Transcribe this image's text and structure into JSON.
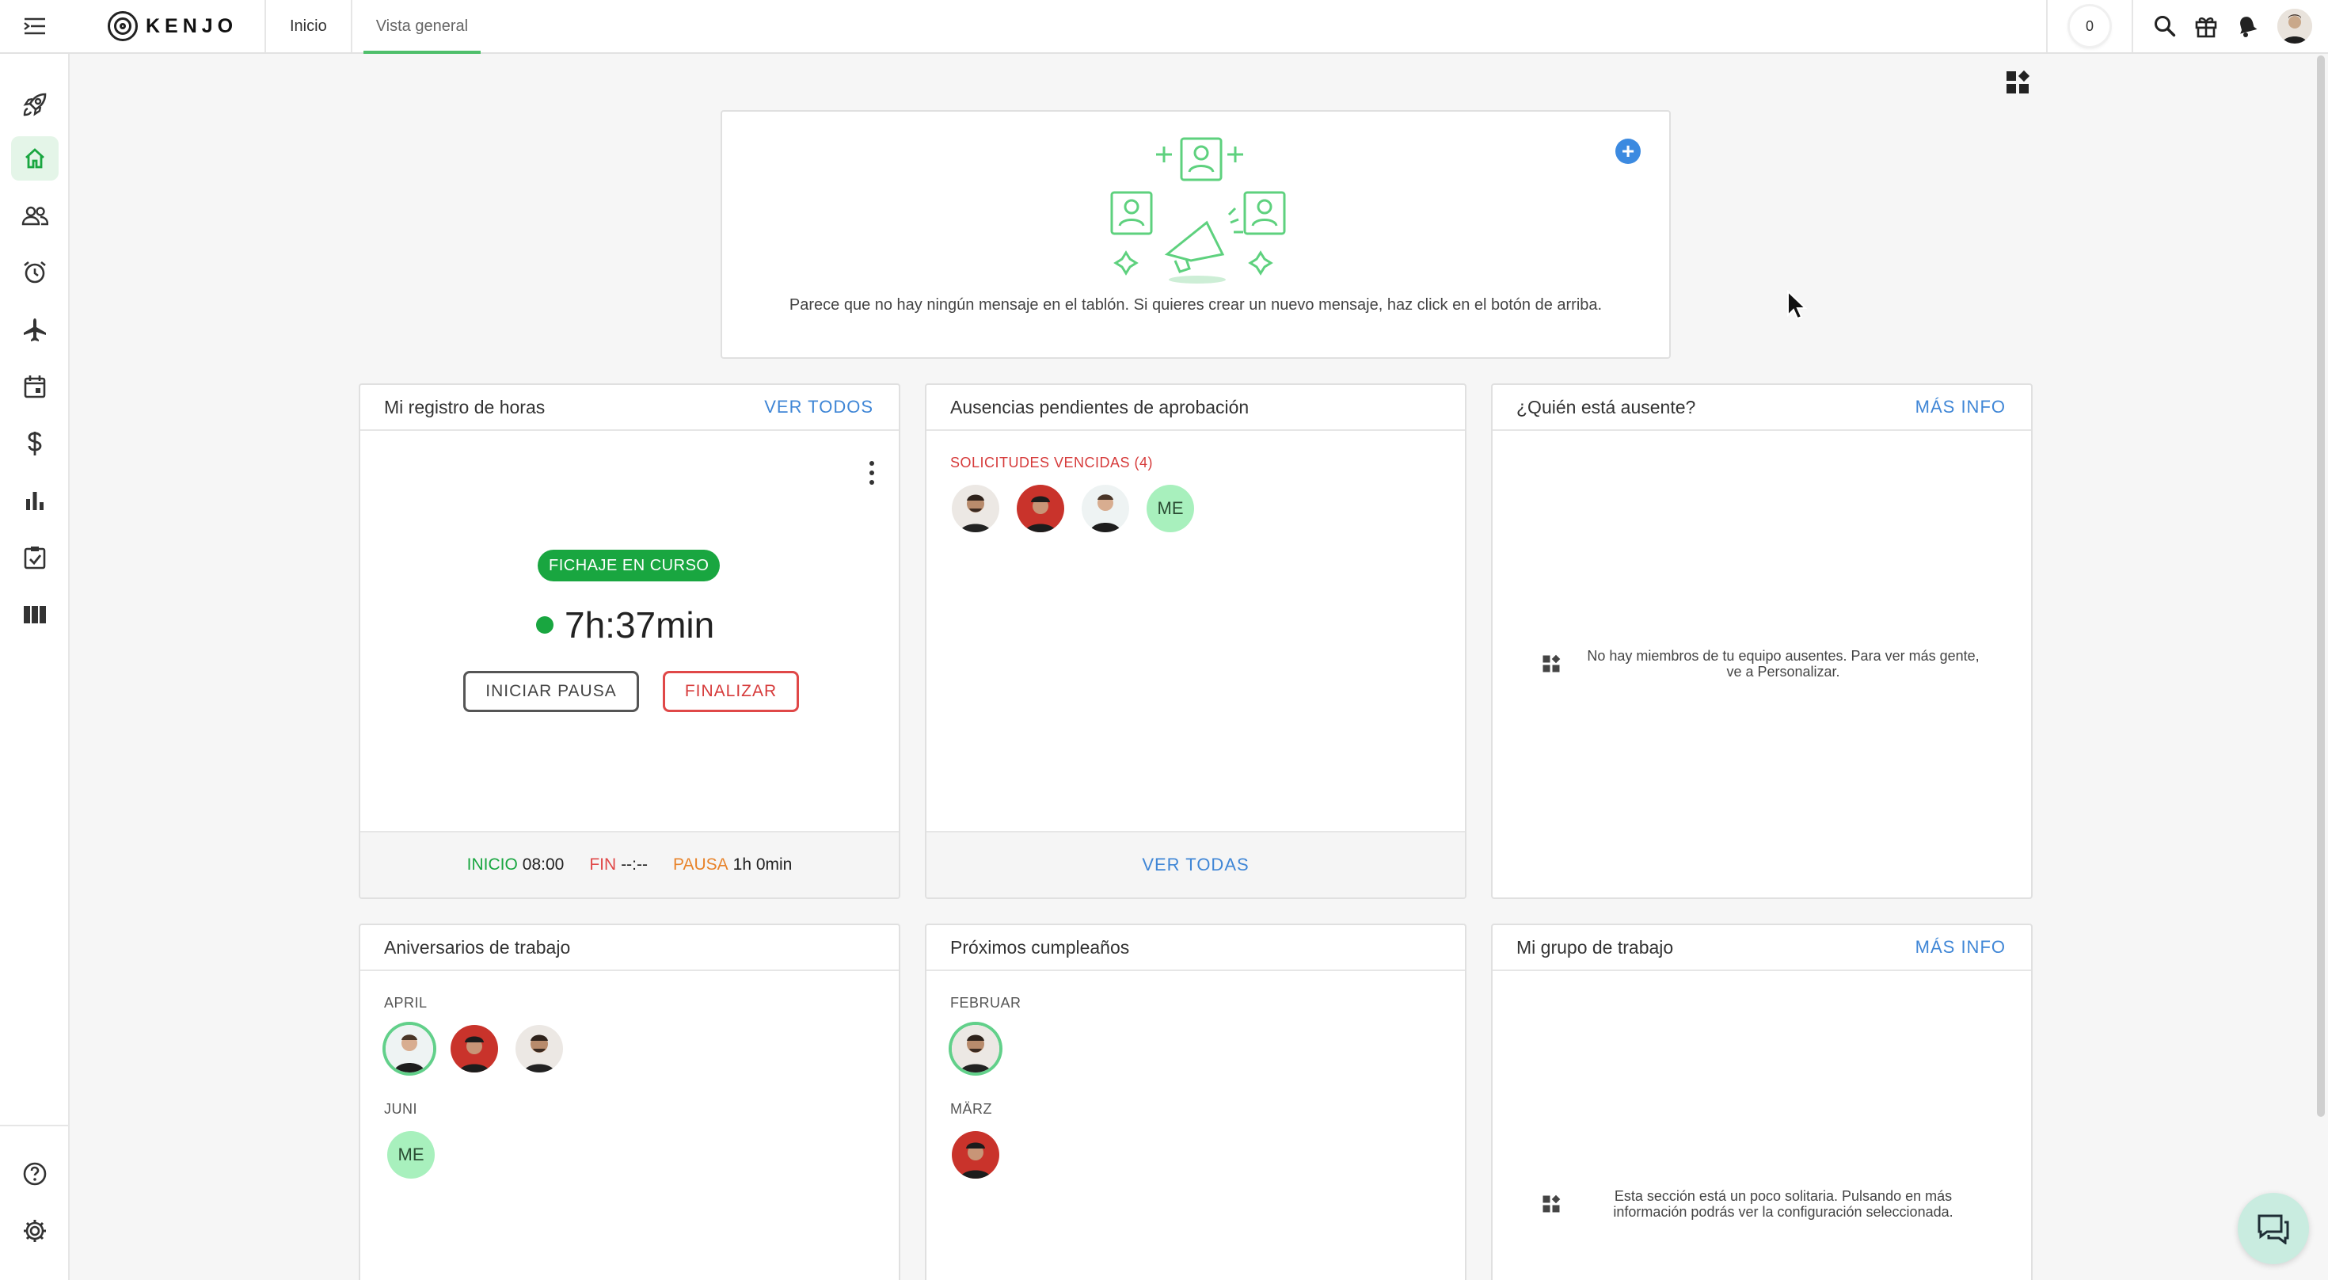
{
  "topbar": {
    "logo_text": "KENJO",
    "tabs": [
      {
        "label": "Inicio"
      },
      {
        "label": "Vista general"
      }
    ],
    "counter": "0"
  },
  "announcements": {
    "empty_text": "Parece que no hay ningún mensaje en el tablón. Si quieres crear un nuevo mensaje, haz click en el botón de arriba.",
    "add_label": "+"
  },
  "time_tracking": {
    "title": "Mi registro de horas",
    "link": "VER TODOS",
    "status_badge": "FICHAJE EN CURSO",
    "timer": "7h:37min",
    "pause_button": "INICIAR PAUSA",
    "finish_button": "FINALIZAR",
    "start_label": "INICIO",
    "start_value": "08:00",
    "end_label": "FIN",
    "end_value": "--:--",
    "pause_label": "PAUSA",
    "pause_value": "1h 0min"
  },
  "pending_absences": {
    "title": "Ausencias pendientes de aprobación",
    "overdue_label": "SOLICITUDES VENCIDAS (4)",
    "me_initials": "ME",
    "link": "VER TODAS"
  },
  "who_absent": {
    "title": "¿Quién está ausente?",
    "link": "MÁS INFO",
    "empty_text": "No hay miembros de tu equipo ausentes. Para ver más gente, ve a Personalizar."
  },
  "anniversaries": {
    "title": "Aniversarios de trabajo",
    "month_1": "APRIL",
    "month_2": "JUNI",
    "me_initials": "ME"
  },
  "birthdays": {
    "title": "Próximos cumpleaños",
    "month_1": "FEBRUAR",
    "month_2": "MÄRZ"
  },
  "work_group": {
    "title": "Mi grupo de trabajo",
    "link": "MÁS INFO",
    "empty_text": "Esta sección está un poco solitaria. Pulsando en más información podrás ver la configuración seleccionada."
  },
  "colors": {
    "accent_green": "#19a640",
    "link_blue": "#3f86d6",
    "danger_red": "#e04848",
    "pause_orange": "#e8832a"
  }
}
